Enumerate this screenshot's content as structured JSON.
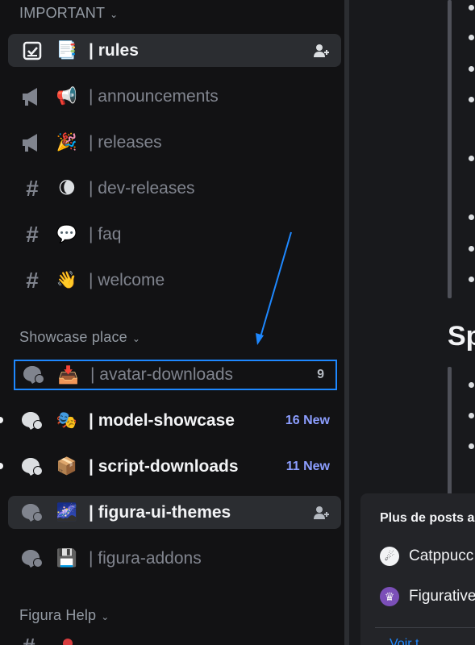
{
  "sidebar": {
    "categories": [
      {
        "label": "IMPORTANT"
      },
      {
        "label": "Showcase place"
      },
      {
        "label": "Figura Help"
      }
    ],
    "channels": [
      {
        "icon": "checkbox-rules-icon",
        "emoji": "📑",
        "name": "| rules",
        "state": "active",
        "action_icon": "add-member-icon"
      },
      {
        "icon": "megaphone-icon",
        "emoji": "📢",
        "name": "| announcements",
        "state": "muted"
      },
      {
        "icon": "megaphone-icon",
        "emoji": "🎉",
        "name": "| releases",
        "state": "muted"
      },
      {
        "icon": "hash-icon",
        "emoji": "🌘",
        "name": "| dev-releases",
        "state": "muted"
      },
      {
        "icon": "hash-icon",
        "emoji": "💬",
        "name": "| faq",
        "state": "muted"
      },
      {
        "icon": "hash-icon",
        "emoji": "👋",
        "name": "| welcome",
        "state": "muted"
      },
      {
        "icon": "forum-icon",
        "emoji": "📥",
        "name": "| avatar-downloads",
        "state": "highlighted",
        "badge": "9"
      },
      {
        "icon": "forum-icon",
        "emoji": "🎭",
        "name": "| model-showcase",
        "state": "unread",
        "badge": "16 New"
      },
      {
        "icon": "forum-icon",
        "emoji": "📦",
        "name": "| script-downloads",
        "state": "unread",
        "badge": "11 New"
      },
      {
        "icon": "forum-icon",
        "emoji": "🌌",
        "name": "| figura-ui-themes",
        "state": "active",
        "action_icon": "add-member-icon"
      },
      {
        "icon": "forum-icon",
        "emoji": "💾",
        "name": "| figura-addons",
        "state": "muted"
      }
    ],
    "chevron_icon": "chevron-down-icon"
  },
  "main": {
    "heading": "Sp",
    "card": {
      "title": "Plus de posts a",
      "items": [
        {
          "avatar_icon": "avatar-icon",
          "label": "Catppucc"
        },
        {
          "avatar_icon": "avatar-icon",
          "label": "Figurative"
        }
      ],
      "link": "Voir t"
    }
  },
  "colors": {
    "highlight_outline": "#1e88ff",
    "new_badge": "#8c9eff",
    "annotation_arrow": "#1e88ff"
  }
}
